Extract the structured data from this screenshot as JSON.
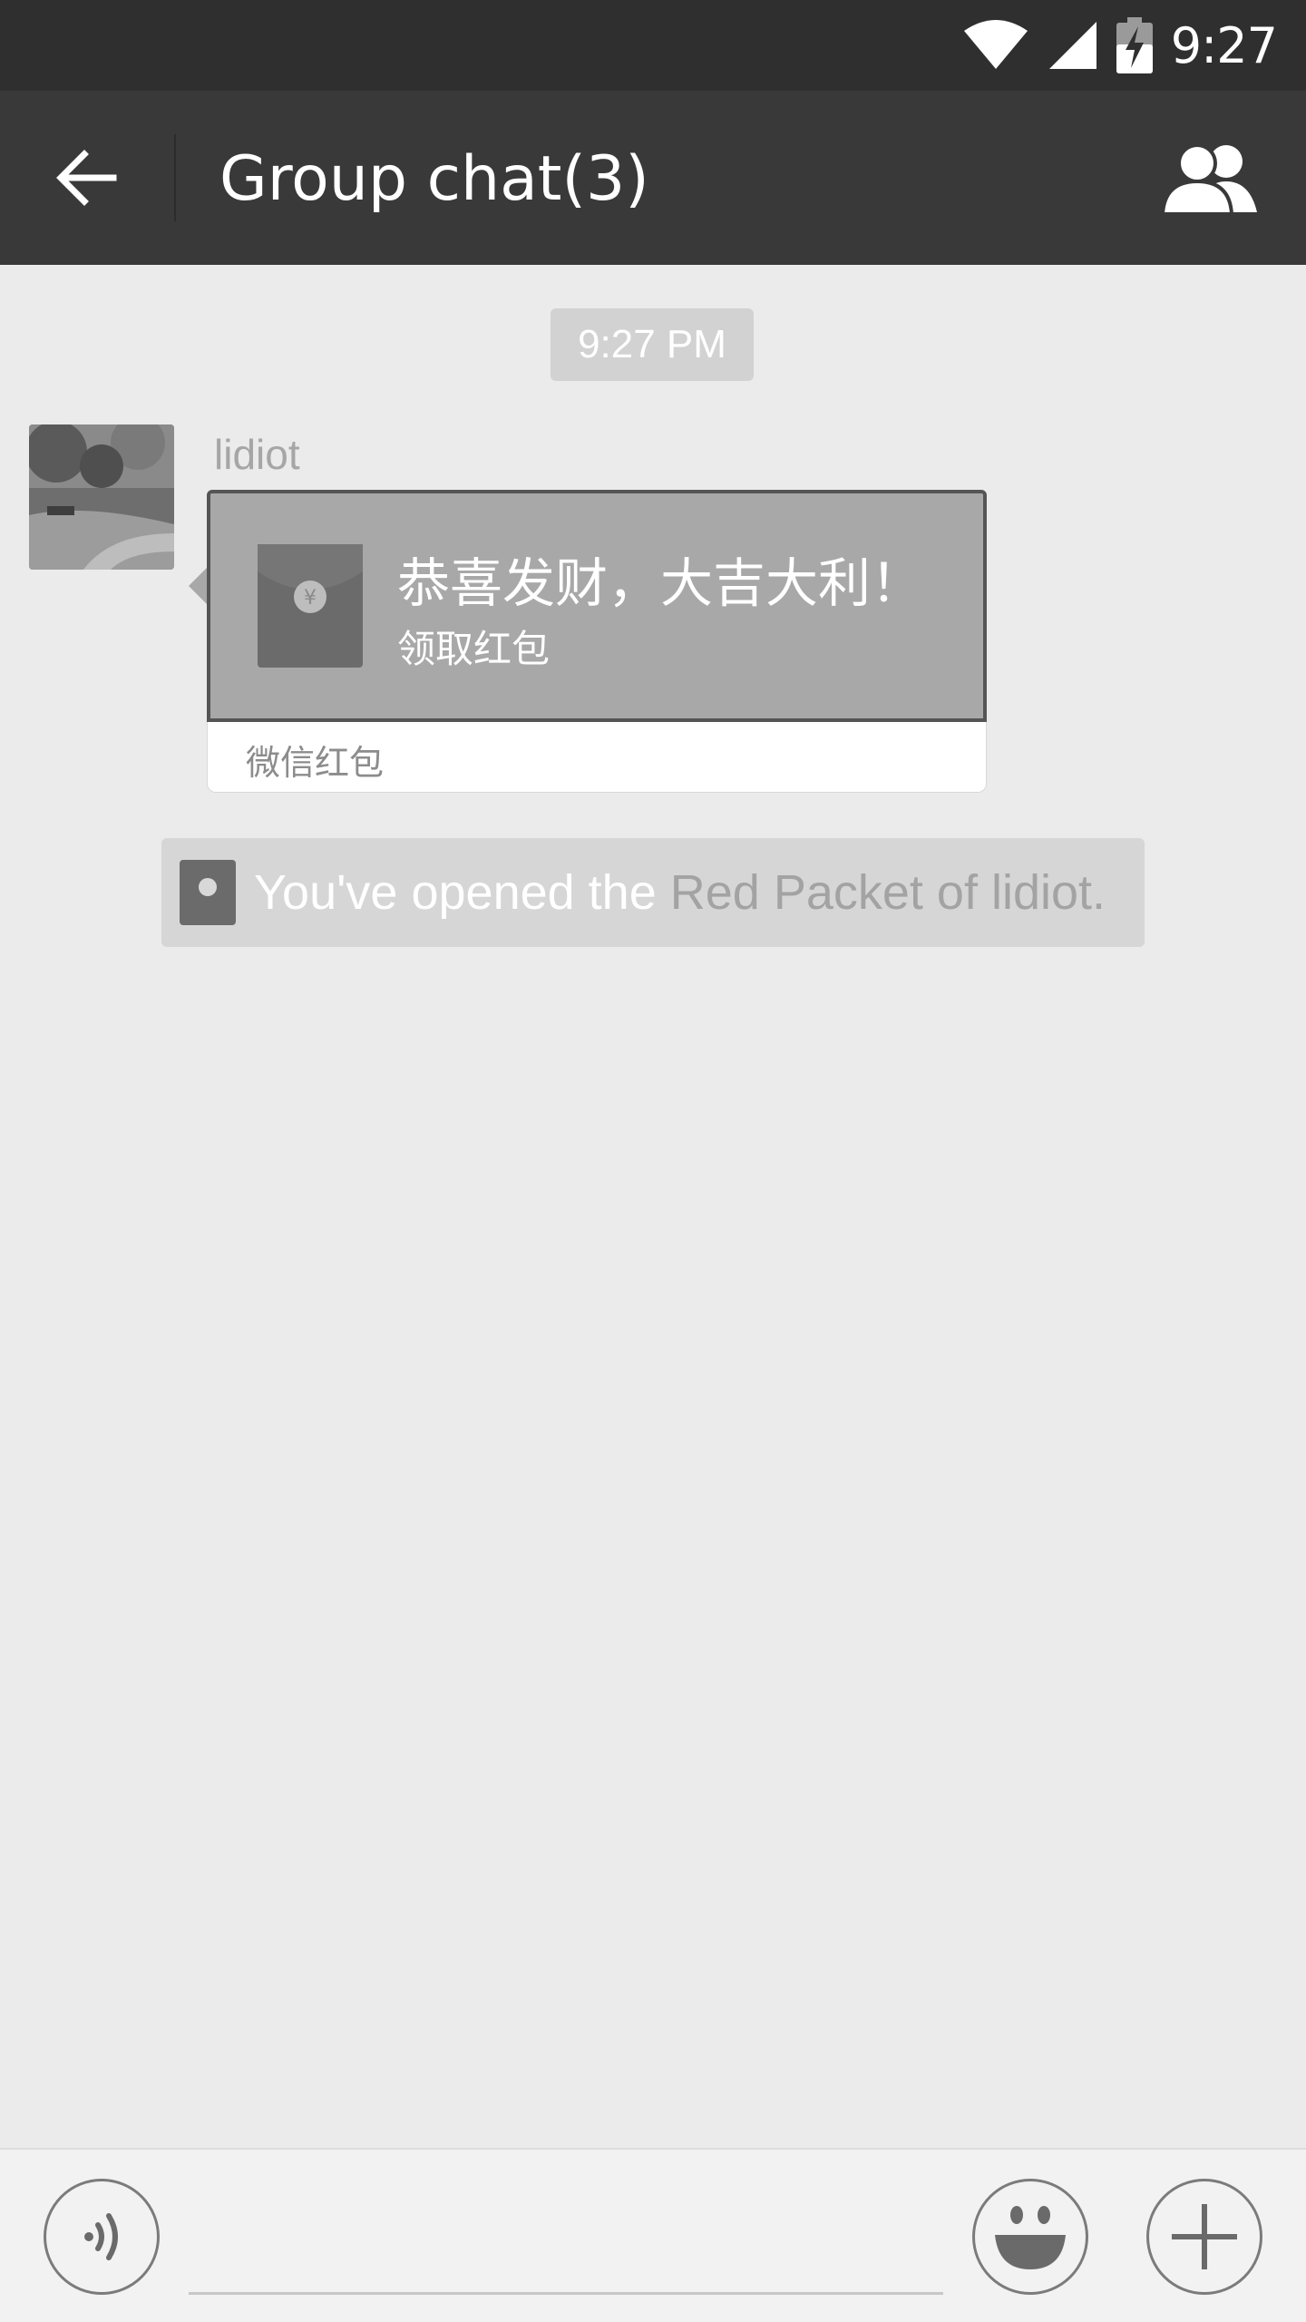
{
  "status_bar": {
    "time": "9:27",
    "icons": [
      "wifi-icon",
      "cell-signal-icon",
      "battery-charging-icon"
    ]
  },
  "app_bar": {
    "title": "Group chat(3)",
    "back_icon": "arrow-left-icon",
    "members_icon": "group-members-icon",
    "background": "#393939"
  },
  "chat": {
    "timestamp": "9:27 PM",
    "messages": [
      {
        "sender": "lidiot",
        "type": "red-packet",
        "packet": {
          "title": "恭喜发财，大吉大利！",
          "subtitle": "领取红包",
          "footer": "微信红包",
          "icon": "red-packet-icon"
        }
      }
    ],
    "system_note": {
      "prefix": "You've opened the ",
      "link": "Red Packet",
      "suffix": " of lidiot.",
      "icon": "red-packet-small-icon"
    }
  },
  "input_bar": {
    "voice_icon": "voice-input-icon",
    "emoji_icon": "emoji-icon",
    "plus_icon": "plus-icon",
    "text_value": ""
  }
}
